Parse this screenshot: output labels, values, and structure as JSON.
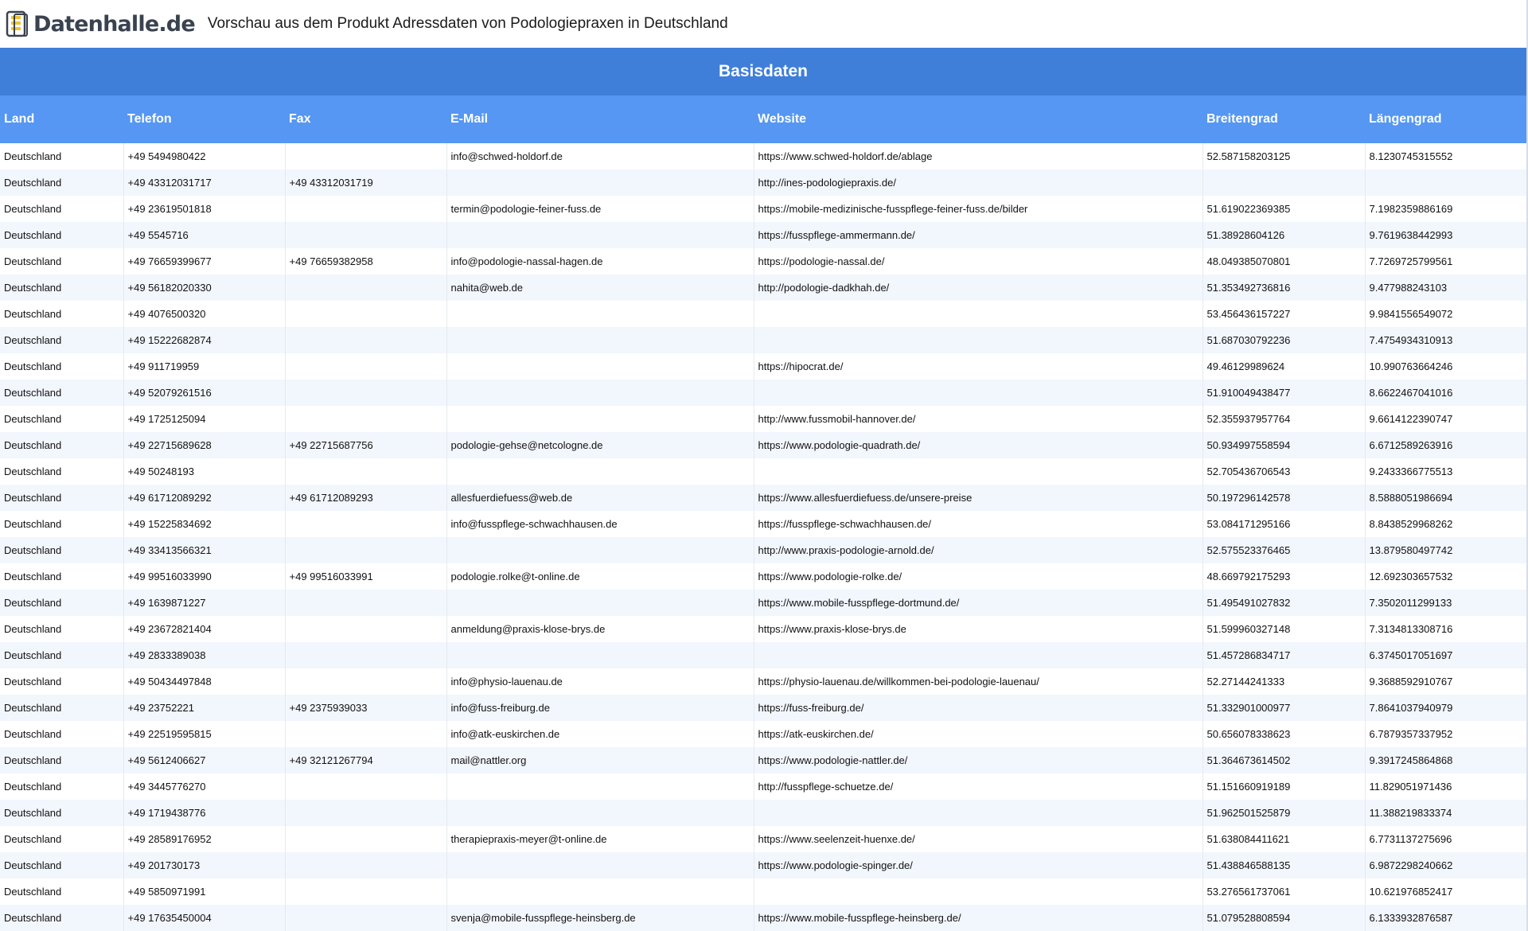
{
  "header": {
    "logo_text": "Datenhalle.de",
    "title": "Vorschau aus dem Produkt Adressdaten von Podologiepraxen in Deutschland"
  },
  "section": {
    "title": "Basisdaten"
  },
  "table": {
    "columns": [
      "Land",
      "Telefon",
      "Fax",
      "E-Mail",
      "Website",
      "Breitengrad",
      "Längengrad"
    ],
    "rows": [
      [
        "Deutschland",
        "+49 5494980422",
        "",
        "info@schwed-holdorf.de",
        "https://www.schwed-holdorf.de/ablage",
        "52.587158203125",
        "8.1230745315552"
      ],
      [
        "Deutschland",
        "+49 43312031717",
        "+49 43312031719",
        "",
        "http://ines-podologiepraxis.de/",
        "",
        ""
      ],
      [
        "Deutschland",
        "+49 23619501818",
        "",
        "termin@podologie-feiner-fuss.de",
        "https://mobile-medizinische-fusspflege-feiner-fuss.de/bilder",
        "51.619022369385",
        "7.1982359886169"
      ],
      [
        "Deutschland",
        "+49 5545716",
        "",
        "",
        "https://fusspflege-ammermann.de/",
        "51.38928604126",
        "9.7619638442993"
      ],
      [
        "Deutschland",
        "+49 76659399677",
        "+49 76659382958",
        "info@podologie-nassal-hagen.de",
        "https://podologie-nassal.de/",
        "48.049385070801",
        "7.7269725799561"
      ],
      [
        "Deutschland",
        "+49 56182020330",
        "",
        "nahita@web.de",
        "http://podologie-dadkhah.de/",
        "51.353492736816",
        "9.477988243103"
      ],
      [
        "Deutschland",
        "+49 4076500320",
        "",
        "",
        "",
        "53.456436157227",
        "9.9841556549072"
      ],
      [
        "Deutschland",
        "+49 15222682874",
        "",
        "",
        "",
        "51.687030792236",
        "7.4754934310913"
      ],
      [
        "Deutschland",
        "+49 911719959",
        "",
        "",
        "https://hipocrat.de/",
        "49.46129989624",
        "10.990763664246"
      ],
      [
        "Deutschland",
        "+49 52079261516",
        "",
        "",
        "",
        "51.910049438477",
        "8.6622467041016"
      ],
      [
        "Deutschland",
        "+49 1725125094",
        "",
        "",
        "http://www.fussmobil-hannover.de/",
        "52.355937957764",
        "9.6614122390747"
      ],
      [
        "Deutschland",
        "+49 22715689628",
        "+49 22715687756",
        "podologie-gehse@netcologne.de",
        "https://www.podologie-quadrath.de/",
        "50.934997558594",
        "6.6712589263916"
      ],
      [
        "Deutschland",
        "+49 50248193",
        "",
        "",
        "",
        "52.705436706543",
        "9.2433366775513"
      ],
      [
        "Deutschland",
        "+49 61712089292",
        "+49 61712089293",
        "allesfuerdiefuess@web.de",
        "https://www.allesfuerdiefuess.de/unsere-preise",
        "50.197296142578",
        "8.5888051986694"
      ],
      [
        "Deutschland",
        "+49 15225834692",
        "",
        "info@fusspflege-schwachhausen.de",
        "https://fusspflege-schwachhausen.de/",
        "53.084171295166",
        "8.8438529968262"
      ],
      [
        "Deutschland",
        "+49 33413566321",
        "",
        "",
        "http://www.praxis-podologie-arnold.de/",
        "52.575523376465",
        "13.879580497742"
      ],
      [
        "Deutschland",
        "+49 99516033990",
        "+49 99516033991",
        "podologie.rolke@t-online.de",
        "https://www.podologie-rolke.de/",
        "48.669792175293",
        "12.692303657532"
      ],
      [
        "Deutschland",
        "+49 1639871227",
        "",
        "",
        "https://www.mobile-fusspflege-dortmund.de/",
        "51.495491027832",
        "7.3502011299133"
      ],
      [
        "Deutschland",
        "+49 23672821404",
        "",
        "anmeldung@praxis-klose-brys.de",
        "https://www.praxis-klose-brys.de",
        "51.599960327148",
        "7.3134813308716"
      ],
      [
        "Deutschland",
        "+49 2833389038",
        "",
        "",
        "",
        "51.457286834717",
        "6.3745017051697"
      ],
      [
        "Deutschland",
        "+49 50434497848",
        "",
        "info@physio-lauenau.de",
        "https://physio-lauenau.de/willkommen-bei-podologie-lauenau/",
        "52.27144241333",
        "9.3688592910767"
      ],
      [
        "Deutschland",
        "+49 23752221",
        "+49 2375939033",
        "info@fuss-freiburg.de",
        "https://fuss-freiburg.de/",
        "51.332901000977",
        "7.8641037940979"
      ],
      [
        "Deutschland",
        "+49 22519595815",
        "",
        "info@atk-euskirchen.de",
        "https://atk-euskirchen.de/",
        "50.656078338623",
        "6.7879357337952"
      ],
      [
        "Deutschland",
        "+49 5612406627",
        "+49 32121267794",
        "mail@nattler.org",
        "https://www.podologie-nattler.de/",
        "51.364673614502",
        "9.3917245864868"
      ],
      [
        "Deutschland",
        "+49 3445776270",
        "",
        "",
        "http://fusspflege-schuetze.de/",
        "51.151660919189",
        "11.829051971436"
      ],
      [
        "Deutschland",
        "+49 1719438776",
        "",
        "",
        "",
        "51.962501525879",
        "11.388219833374"
      ],
      [
        "Deutschland",
        "+49 28589176952",
        "",
        "therapiepraxis-meyer@t-online.de",
        "https://www.seelenzeit-huenxe.de/",
        "51.638084411621",
        "6.7731137275696"
      ],
      [
        "Deutschland",
        "+49 201730173",
        "",
        "",
        "https://www.podologie-spinger.de/",
        "51.438846588135",
        "6.9872298240662"
      ],
      [
        "Deutschland",
        "+49 5850971991",
        "",
        "",
        "",
        "53.276561737061",
        "10.621976852417"
      ],
      [
        "Deutschland",
        "+49 17635450004",
        "",
        "svenja@mobile-fusspflege-heinsberg.de",
        "https://www.mobile-fusspflege-heinsberg.de/",
        "51.079528808594",
        "6.1333932876587"
      ]
    ]
  }
}
